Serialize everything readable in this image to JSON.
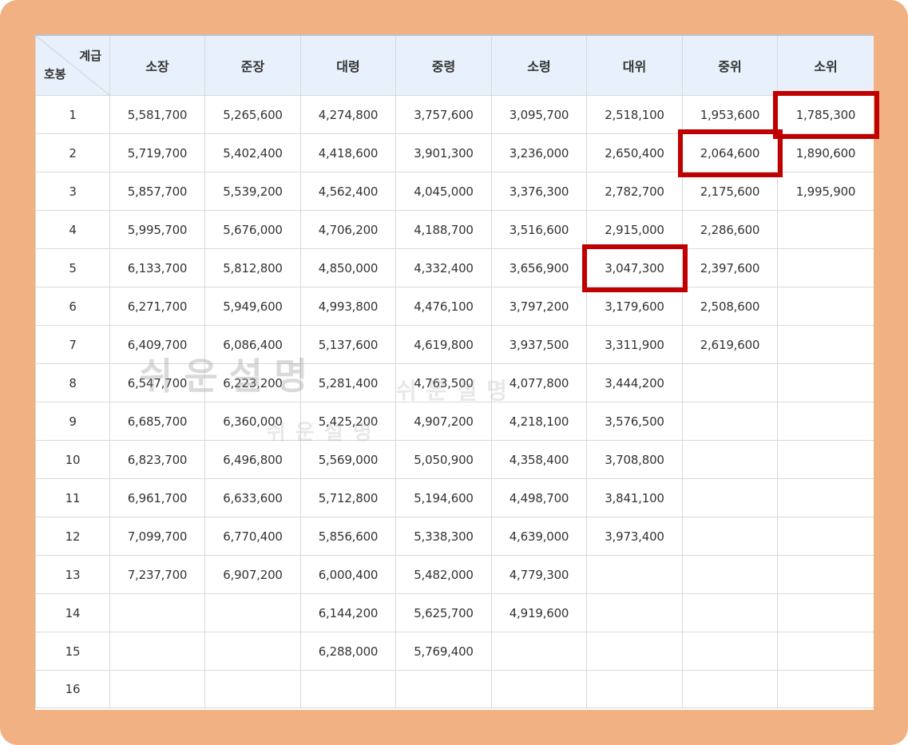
{
  "table": {
    "corner_top": "계급",
    "corner_bottom": "호봉",
    "headers": [
      "소장",
      "준장",
      "대령",
      "중령",
      "소령",
      "대위",
      "중위",
      "소위"
    ],
    "rows": [
      [
        "1",
        "5,581,700",
        "5,265,600",
        "4,274,800",
        "3,757,600",
        "3,095,700",
        "2,518,100",
        "1,953,600",
        "1,785,300"
      ],
      [
        "2",
        "5,719,700",
        "5,402,400",
        "4,418,600",
        "3,901,300",
        "3,236,000",
        "2,650,400",
        "2,064,600",
        "1,890,600"
      ],
      [
        "3",
        "5,857,700",
        "5,539,200",
        "4,562,400",
        "4,045,000",
        "3,376,300",
        "2,782,700",
        "2,175,600",
        "1,995,900"
      ],
      [
        "4",
        "5,995,700",
        "5,676,000",
        "4,706,200",
        "4,188,700",
        "3,516,600",
        "2,915,000",
        "2,286,600",
        ""
      ],
      [
        "5",
        "6,133,700",
        "5,812,800",
        "4,850,000",
        "4,332,400",
        "3,656,900",
        "3,047,300",
        "2,397,600",
        ""
      ],
      [
        "6",
        "6,271,700",
        "5,949,600",
        "4,993,800",
        "4,476,100",
        "3,797,200",
        "3,179,600",
        "2,508,600",
        ""
      ],
      [
        "7",
        "6,409,700",
        "6,086,400",
        "5,137,600",
        "4,619,800",
        "3,937,500",
        "3,311,900",
        "2,619,600",
        ""
      ],
      [
        "8",
        "6,547,700",
        "6,223,200",
        "5,281,400",
        "4,763,500",
        "4,077,800",
        "3,444,200",
        "",
        ""
      ],
      [
        "9",
        "6,685,700",
        "6,360,000",
        "5,425,200",
        "4,907,200",
        "4,218,100",
        "3,576,500",
        "",
        ""
      ],
      [
        "10",
        "6,823,700",
        "6,496,800",
        "5,569,000",
        "5,050,900",
        "4,358,400",
        "3,708,800",
        "",
        ""
      ],
      [
        "11",
        "6,961,700",
        "6,633,600",
        "5,712,800",
        "5,194,600",
        "4,498,700",
        "3,841,100",
        "",
        ""
      ],
      [
        "12",
        "7,099,700",
        "6,770,400",
        "5,856,600",
        "5,338,300",
        "4,639,000",
        "3,973,400",
        "",
        ""
      ],
      [
        "13",
        "7,237,700",
        "6,907,200",
        "6,000,400",
        "5,482,000",
        "4,779,300",
        "",
        "",
        ""
      ],
      [
        "14",
        "",
        "",
        "6,144,200",
        "5,625,700",
        "4,919,600",
        "",
        "",
        ""
      ],
      [
        "15",
        "",
        "",
        "6,288,000",
        "5,769,400",
        "",
        "",
        "",
        ""
      ],
      [
        "16",
        "",
        "",
        "",
        "",
        "",
        "",
        "",
        ""
      ]
    ]
  },
  "highlights": [
    {
      "row": 1,
      "col": 8
    },
    {
      "row": 2,
      "col": 7
    },
    {
      "row": 5,
      "col": 6
    }
  ],
  "watermark": {
    "large": "쉬운설명",
    "small_1": "쉬운설명",
    "small_2": "쉬운설명"
  },
  "colors": {
    "frame": "#f2b183",
    "header_bg": "#e8f0fb",
    "highlight": "#c00000"
  }
}
